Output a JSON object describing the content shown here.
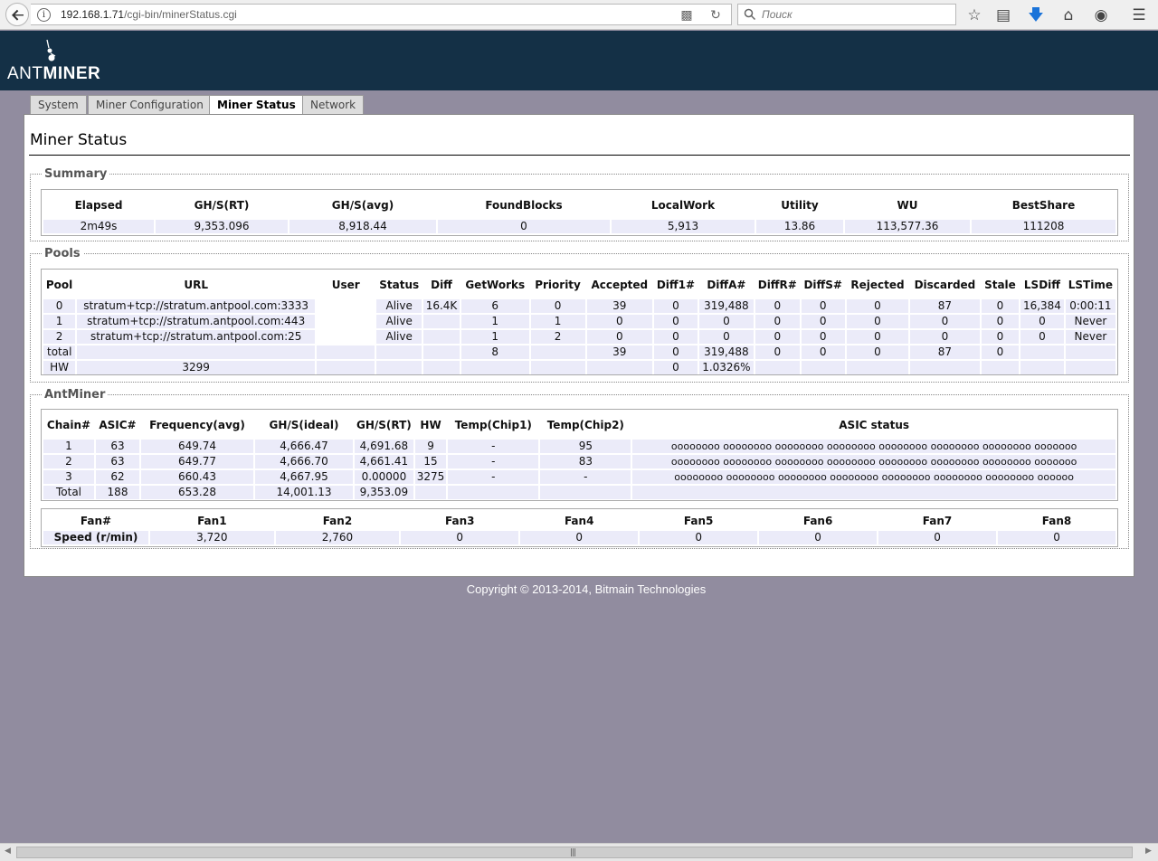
{
  "browser": {
    "url_host": "192.168.1.71",
    "url_path": "/cgi-bin/minerStatus.cgi",
    "search_placeholder": "Поиск"
  },
  "logo": {
    "ant": "ANT",
    "miner": "MINER"
  },
  "tabs": [
    {
      "label": "System"
    },
    {
      "label": "Miner Configuration"
    },
    {
      "label": "Miner Status"
    },
    {
      "label": "Network"
    }
  ],
  "page_title": "Miner Status",
  "summary": {
    "legend": "Summary",
    "headers": [
      "Elapsed",
      "GH/S(RT)",
      "GH/S(avg)",
      "FoundBlocks",
      "LocalWork",
      "Utility",
      "WU",
      "BestShare"
    ],
    "row": [
      "2m49s",
      "9,353.096",
      "8,918.44",
      "0",
      "5,913",
      "13.86",
      "113,577.36",
      "111208"
    ]
  },
  "pools": {
    "legend": "Pools",
    "headers": [
      "Pool",
      "URL",
      "User",
      "Status",
      "Diff",
      "GetWorks",
      "Priority",
      "Accepted",
      "Diff1#",
      "DiffA#",
      "DiffR#",
      "DiffS#",
      "Rejected",
      "Discarded",
      "Stale",
      "LSDiff",
      "LSTime"
    ],
    "rows": [
      [
        "0",
        "stratum+tcp://stratum.antpool.com:3333",
        "",
        "Alive",
        "16.4K",
        "6",
        "0",
        "39",
        "0",
        "319,488",
        "0",
        "0",
        "0",
        "87",
        "0",
        "16,384",
        "0:00:11"
      ],
      [
        "1",
        "stratum+tcp://stratum.antpool.com:443",
        "",
        "Alive",
        "",
        "1",
        "1",
        "0",
        "0",
        "0",
        "0",
        "0",
        "0",
        "0",
        "0",
        "0",
        "Never"
      ],
      [
        "2",
        "stratum+tcp://stratum.antpool.com:25",
        "",
        "Alive",
        "",
        "1",
        "2",
        "0",
        "0",
        "0",
        "0",
        "0",
        "0",
        "0",
        "0",
        "0",
        "Never"
      ],
      [
        "total",
        "",
        "",
        "",
        "",
        "8",
        "",
        "39",
        "0",
        "319,488",
        "0",
        "0",
        "0",
        "87",
        "0",
        "",
        ""
      ]
    ],
    "hw_label": "HW",
    "hw_value": "3299",
    "hw_diff1": "0",
    "hw_pct": "1.0326%"
  },
  "antminer": {
    "legend": "AntMiner",
    "headers": [
      "Chain#",
      "ASIC#",
      "Frequency(avg)",
      "GH/S(ideal)",
      "GH/S(RT)",
      "HW",
      "Temp(Chip1)",
      "Temp(Chip2)",
      "ASIC status"
    ],
    "rows": [
      [
        "1",
        "63",
        "649.74",
        "4,666.47",
        "4,691.68",
        "9",
        "-",
        "95",
        "oooooooo oooooooo oooooooo oooooooo oooooooo oooooooo oooooooo ooooooo"
      ],
      [
        "2",
        "63",
        "649.77",
        "4,666.70",
        "4,661.41",
        "15",
        "-",
        "83",
        "oooooooo oooooooo oooooooo oooooooo oooooooo oooooooo oooooooo ooooooo"
      ],
      [
        "3",
        "62",
        "660.43",
        "4,667.95",
        "0.00000",
        "3275",
        "-",
        "-",
        "oooooooo oooooooo oooooooo oooooooo oooooooo oooooooo oooooooo oooooo"
      ],
      [
        "Total",
        "188",
        "653.28",
        "14,001.13",
        "9,353.09",
        "",
        "",
        "",
        ""
      ]
    ]
  },
  "fans": {
    "headers": [
      "Fan#",
      "Fan1",
      "Fan2",
      "Fan3",
      "Fan4",
      "Fan5",
      "Fan6",
      "Fan7",
      "Fan8"
    ],
    "row_label": "Speed (r/min)",
    "values": [
      "3,720",
      "2,760",
      "0",
      "0",
      "0",
      "0",
      "0",
      "0"
    ]
  },
  "footer": "Copyright © 2013-2014, Bitmain Technologies"
}
